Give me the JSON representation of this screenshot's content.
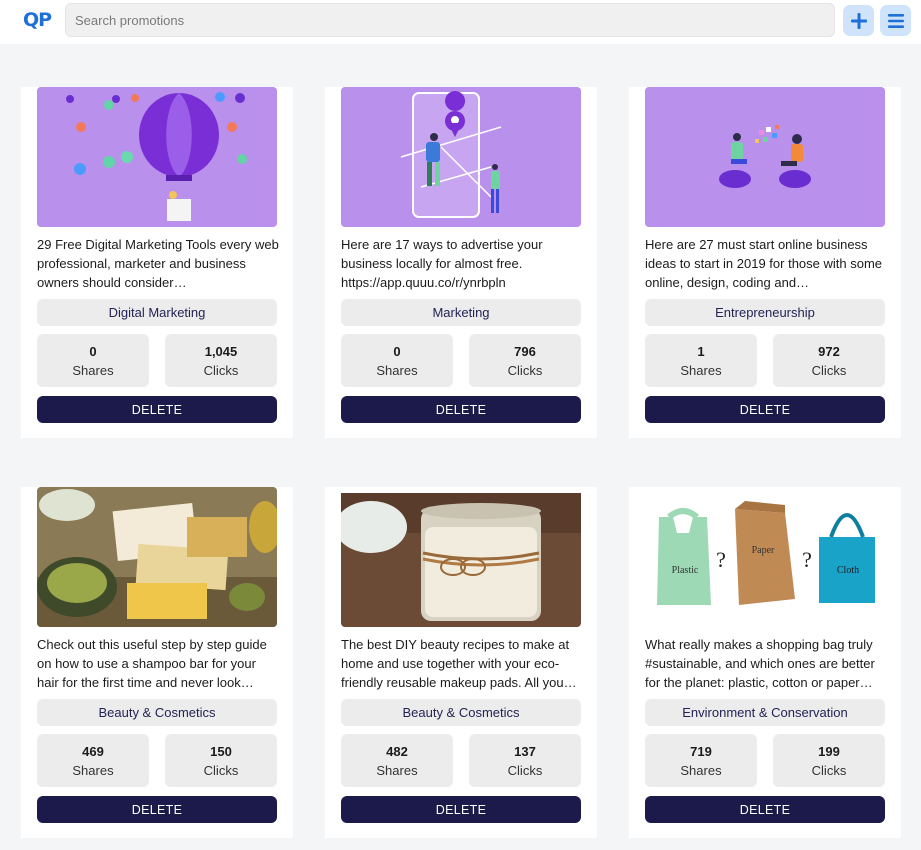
{
  "app": {
    "logo_text": "QP",
    "search_placeholder": "Search promotions",
    "add_icon": "plus-icon",
    "menu_icon": "hamburger-menu-icon",
    "accent_color": "#1f6fd8",
    "delete_color": "#1b1a4a"
  },
  "promotions": [
    {
      "description": "29 Free Digital Marketing Tools every web professional, marketer and business owners should consider…",
      "category": "Digital Marketing",
      "shares": "0",
      "shares_label": "Shares",
      "clicks": "1,045",
      "clicks_label": "Clicks",
      "delete_label": "DELETE"
    },
    {
      "description": "Here are 17 ways to advertise your business locally for almost free. https://app.quuu.co/r/ynrbpln",
      "category": "Marketing",
      "shares": "0",
      "shares_label": "Shares",
      "clicks": "796",
      "clicks_label": "Clicks",
      "delete_label": "DELETE"
    },
    {
      "description": "Here are 27 must start online business ideas to start in 2019 for those with some online, design, coding and…",
      "category": "Entrepreneurship",
      "shares": "1",
      "shares_label": "Shares",
      "clicks": "972",
      "clicks_label": "Clicks",
      "delete_label": "DELETE"
    },
    {
      "description": "Check out this useful step by step guide on how to use a shampoo bar for your hair for the first time and never look…",
      "category": "Beauty & Cosmetics",
      "shares": "469",
      "shares_label": "Shares",
      "clicks": "150",
      "clicks_label": "Clicks",
      "delete_label": "DELETE"
    },
    {
      "description": "The best DIY beauty recipes to make at home and use together with your eco-friendly reusable makeup pads. All you…",
      "category": "Beauty & Cosmetics",
      "shares": "482",
      "shares_label": "Shares",
      "clicks": "137",
      "clicks_label": "Clicks",
      "delete_label": "DELETE"
    },
    {
      "description": "What really makes a shopping bag truly #sustainable, and which ones are better for the planet: plastic, cotton or paper…",
      "category": "Environment & Conservation",
      "shares": "719",
      "shares_label": "Shares",
      "clicks": "199",
      "clicks_label": "Clicks",
      "delete_label": "DELETE",
      "image_labels": [
        "Plastic",
        "Paper",
        "Cloth"
      ]
    }
  ]
}
